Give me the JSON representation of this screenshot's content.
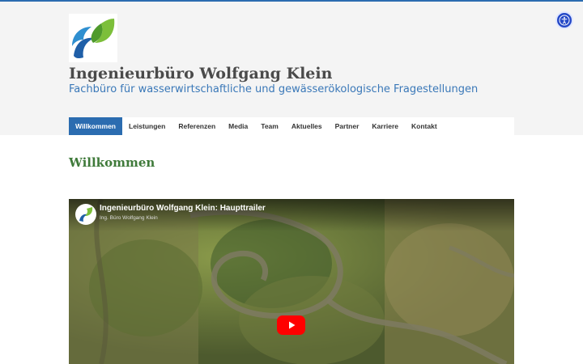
{
  "header": {
    "title": "Ingenieurbüro Wolfgang Klein",
    "subtitle": "Fachbüro für wasserwirtschaftliche und gewässerökologische Fragestellungen",
    "logo_icon": "leaf-water-logo-icon",
    "accessibility_icon": "accessibility-icon"
  },
  "nav": {
    "items": [
      {
        "label": "Willkommen",
        "active": true
      },
      {
        "label": "Leistungen",
        "active": false
      },
      {
        "label": "Referenzen",
        "active": false
      },
      {
        "label": "Media",
        "active": false
      },
      {
        "label": "Team",
        "active": false
      },
      {
        "label": "Aktuelles",
        "active": false
      },
      {
        "label": "Partner",
        "active": false
      },
      {
        "label": "Karriere",
        "active": false
      },
      {
        "label": "Kontakt",
        "active": false
      }
    ]
  },
  "main": {
    "page_title": "Willkommen",
    "video": {
      "title": "Ingenieurbüro Wolfgang Klein: Haupttrailer",
      "channel": "Ing. Büro Wolfgang Klein",
      "play_icon": "youtube-play-icon"
    }
  },
  "colors": {
    "accent": "#2b6cb0",
    "title_green": "#3f7a3a",
    "subtitle_blue": "#3a78b8",
    "play_red": "#ff0000"
  }
}
